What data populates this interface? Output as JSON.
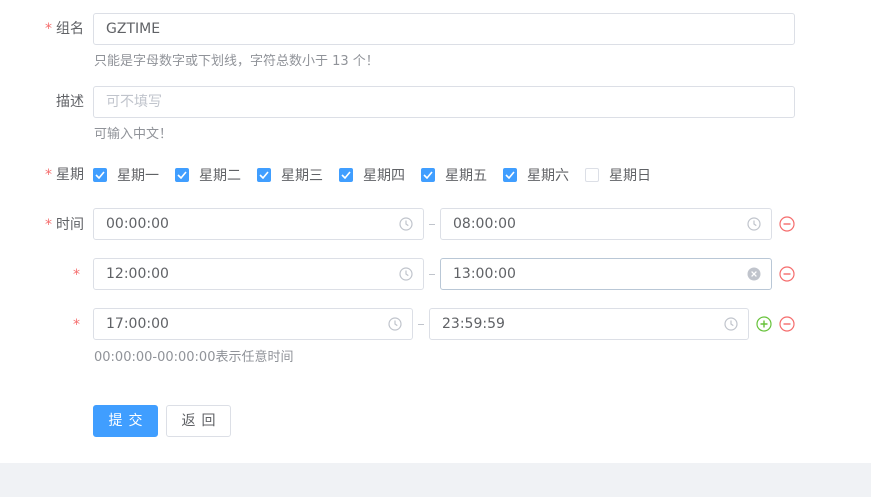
{
  "form": {
    "group_name": {
      "label": "组名",
      "required_mark": "*",
      "value": "GZTIME",
      "hint": "只能是字母数字或下划线，字符总数小于 13 个！"
    },
    "description": {
      "label": "描述",
      "placeholder": "可不填写",
      "hint": "可输入中文！"
    },
    "weekdays": {
      "label": "星期",
      "required_mark": "*",
      "options": [
        {
          "label": "星期一",
          "checked": true
        },
        {
          "label": "星期二",
          "checked": true
        },
        {
          "label": "星期三",
          "checked": true
        },
        {
          "label": "星期四",
          "checked": true
        },
        {
          "label": "星期五",
          "checked": true
        },
        {
          "label": "星期六",
          "checked": true
        },
        {
          "label": "星期日",
          "checked": false
        }
      ]
    },
    "time": {
      "label": "时间",
      "required_mark": "*",
      "ranges": [
        {
          "start": "00:00:00",
          "end": "08:00:00"
        },
        {
          "start": "12:00:00",
          "end": "13:00:00"
        },
        {
          "start": "17:00:00",
          "end": "23:59:59"
        }
      ],
      "hint": "00:00:00-00:00:00表示任意时间"
    },
    "buttons": {
      "submit": "提交",
      "back": "返回"
    }
  },
  "colors": {
    "primary": "#409eff",
    "danger": "#f56c6c",
    "success": "#67c23a",
    "border": "#dcdfe6",
    "text": "#606266",
    "hint": "#909399"
  },
  "icons": [
    "clock-icon",
    "clear-icon",
    "remove-circle-icon",
    "add-circle-icon",
    "check-icon"
  ]
}
